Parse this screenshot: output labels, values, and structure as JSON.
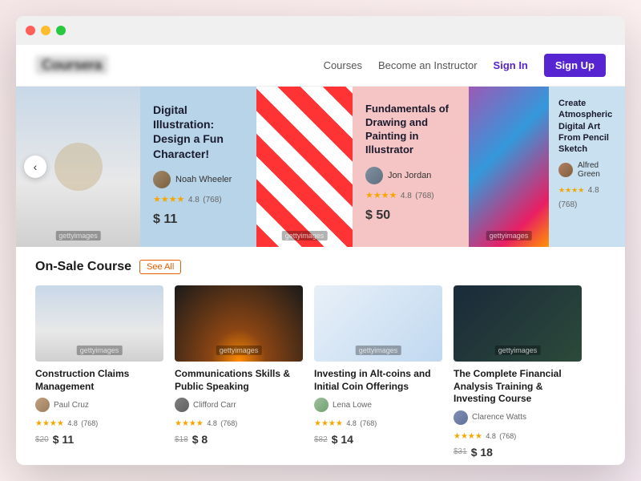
{
  "window": {
    "dots": [
      "red",
      "yellow",
      "green"
    ]
  },
  "navbar": {
    "logo": "Coursera",
    "links": [
      {
        "label": "Courses",
        "id": "courses"
      },
      {
        "label": "Become an Instructor",
        "id": "become-instructor"
      },
      {
        "label": "Sign In",
        "id": "signin"
      },
      {
        "label": "Sign Up",
        "id": "signup"
      }
    ]
  },
  "hero": {
    "nav_prev": "‹",
    "cards": [
      {
        "id": "card-illustration",
        "type": "text",
        "title": "Digital Illustration: Design a Fun Character!",
        "instructor": "Noah Wheeler",
        "rating": "4.8",
        "review_count": "(768)",
        "price": "$ 11",
        "bg": "light-blue"
      },
      {
        "id": "card-painting",
        "type": "text",
        "title": "Fundamentals of Drawing and Painting in Illustrator",
        "instructor": "Jon Jordan",
        "rating": "4.8",
        "review_count": "(768)",
        "price": "$ 50",
        "bg": "light-pink"
      },
      {
        "id": "card-sketch",
        "type": "text",
        "title": "Create Atmospheric Digital Art From Pencil Sketch",
        "instructor": "Alfred Green",
        "rating": "4.8",
        "review_count": "(768)",
        "bg": "light-blue-2"
      }
    ],
    "watermark": "gettyimages"
  },
  "onsale": {
    "title": "On-Sale Course",
    "see_all": "See All",
    "courses": [
      {
        "id": "construction",
        "title": "Construction Claims Management",
        "instructor": "Paul Cruz",
        "rating": "4.8",
        "review_count": "(768)",
        "price_old": "$20",
        "price_new": "$ 11"
      },
      {
        "id": "communications",
        "title": "Communications Skills & Public Speaking",
        "instructor": "Clifford Carr",
        "rating": "4.8",
        "review_count": "(768)",
        "price_old": "$18",
        "price_new": "$ 8"
      },
      {
        "id": "investing",
        "title": "Investing in Alt-coins and Initial Coin Offerings",
        "instructor": "Lena Lowe",
        "rating": "4.8",
        "review_count": "(768)",
        "price_old": "$82",
        "price_new": "$ 14"
      },
      {
        "id": "financial",
        "title": "The Complete Financial Analysis Training & Investing Course",
        "instructor": "Clarence Watts",
        "rating": "4.8",
        "review_count": "(768)",
        "price_old": "$31",
        "price_new": "$ 18"
      }
    ]
  }
}
